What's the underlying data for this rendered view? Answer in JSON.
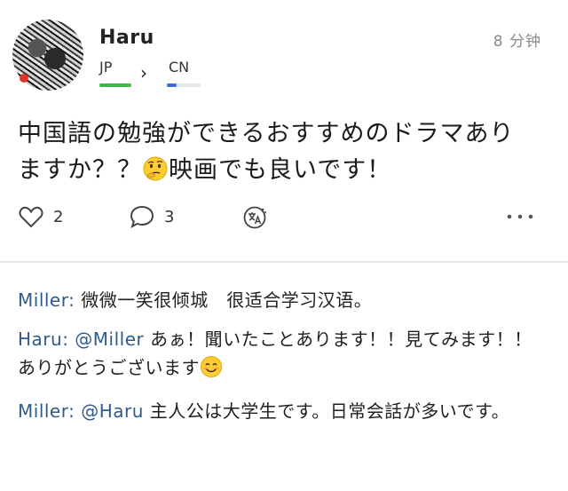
{
  "post": {
    "author": "Haru",
    "timestamp": "8 分钟",
    "language_from": "JP",
    "language_to": "CN",
    "language_to_progress": 0.3,
    "text_line1": "中国語の勉強ができるおすすめのドラマあり",
    "text_line2_before_emoji": "ますか？？",
    "text_emoji": "thinking-face-emoji",
    "text_line2_after_emoji": "映画でも良いです！",
    "likes": "2",
    "comments_count": "3",
    "colors": {
      "from_bar": "#3fb54a",
      "to_bar_fill": "#3b6fd6",
      "name_link": "#2f5b8c"
    }
  },
  "comments": [
    {
      "author": "Miller:",
      "mention": "",
      "text": "微微一笑很倾城　很适合学习汉语。"
    },
    {
      "author": "Haru:",
      "mention": "@Miller",
      "text": "あぁ！聞いたことあります！！見てみます！！ありがとうございます",
      "emoji": "smiling-face-emoji"
    },
    {
      "author": "Miller:",
      "mention": "@Haru",
      "text": "主人公は大学生です。日常会話が多いです。"
    }
  ]
}
